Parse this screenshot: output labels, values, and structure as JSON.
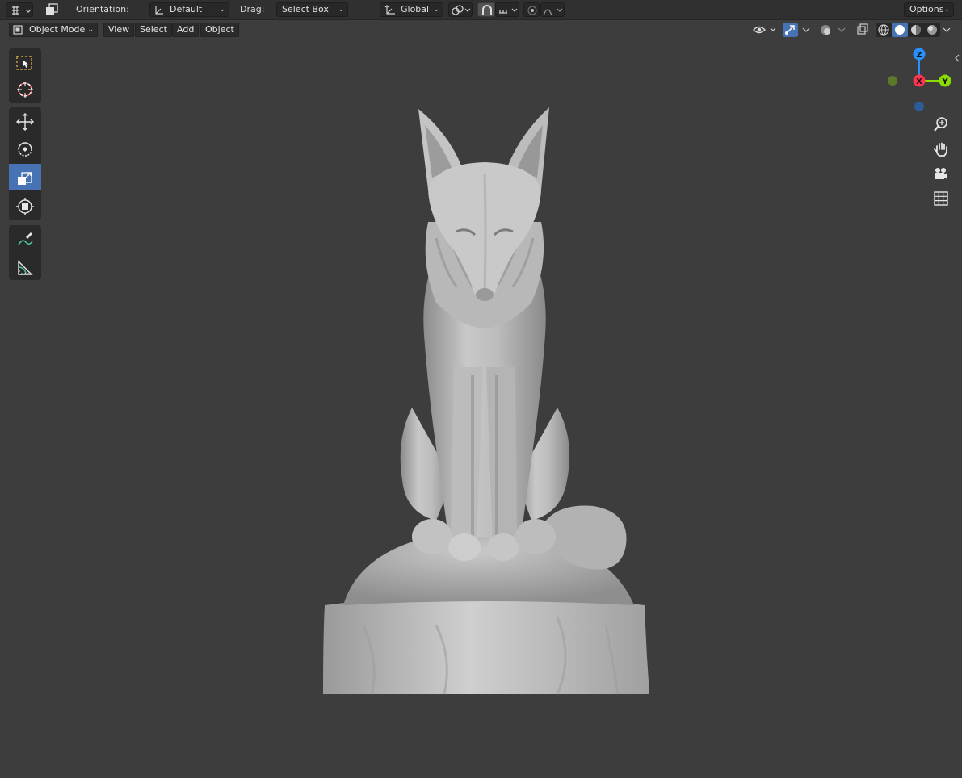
{
  "header": {
    "editor_type_icon": "viewport-transform-icon",
    "orientation_label": "Orientation:",
    "orientation_value": "Default",
    "drag_label": "Drag:",
    "drag_value": "Select Box",
    "transform_orientation": "Global",
    "options_label": "Options"
  },
  "menubar": {
    "mode": "Object Mode",
    "view": "View",
    "select": "Select",
    "add": "Add",
    "object": "Object"
  },
  "toolbar": {
    "tools": [
      "select-box-icon",
      "cursor-icon",
      "move-icon",
      "rotate-icon",
      "scale-icon",
      "transform-icon",
      "annotate-icon",
      "measure-icon"
    ],
    "active_tool": "scale-icon"
  },
  "gizmo": {
    "z": "Z",
    "x": "X",
    "y": "Y",
    "colors": {
      "x": "#ff3352",
      "y": "#8bdc00",
      "z": "#2890ff",
      "neg_y": "#5a7a2a",
      "neg_z": "#2d5a99"
    }
  },
  "navigation": [
    "zoom-icon",
    "pan-hand-icon",
    "camera-icon",
    "ortho-grid-icon"
  ],
  "viewport": {
    "background": "#3d3d3d",
    "object": "fox-statue-mesh"
  }
}
